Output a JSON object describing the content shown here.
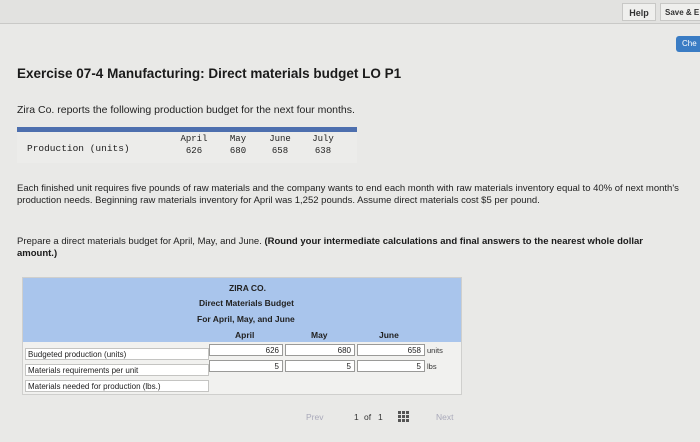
{
  "toolbar": {
    "help": "Help",
    "save": "Save & E",
    "check": "Che"
  },
  "title": "Exercise 07-4 Manufacturing: Direct materials budget LO P1",
  "intro": "Zira Co. reports the following production budget for the next four months.",
  "production_table": {
    "row_label": "Production (units)",
    "months": [
      "April",
      "May",
      "June",
      "July"
    ],
    "values": [
      "626",
      "680",
      "658",
      "638"
    ]
  },
  "paragraph1": "Each finished unit requires five pounds of raw materials and the company wants to end each month with raw materials inventory equal to 40% of next month's production needs. Beginning raw materials inventory for April was 1,252 pounds. Assume direct materials cost $5 per pound.",
  "paragraph2_lead": "Prepare a direct materials budget for April, May, and June. ",
  "paragraph2_bold": "(Round your intermediate calculations and final answers to the nearest whole dollar amount.)",
  "budget": {
    "company": "ZIRA CO.",
    "heading": "Direct Materials Budget",
    "period": "For April, May, and June",
    "columns": [
      "April",
      "May",
      "June"
    ],
    "rows": [
      {
        "label": "Budgeted production (units)",
        "values": [
          "626",
          "680",
          "658"
        ],
        "unit": "units"
      },
      {
        "label": "Materials requirements per unit",
        "values": [
          "5",
          "5",
          "5"
        ],
        "unit": "lbs"
      },
      {
        "label": "Materials needed for production (lbs.)",
        "values": [
          "",
          "",
          ""
        ],
        "unit": ""
      }
    ]
  },
  "pager": {
    "prev": "Prev",
    "page": "1",
    "of": "of",
    "total": "1",
    "next": "Next"
  }
}
